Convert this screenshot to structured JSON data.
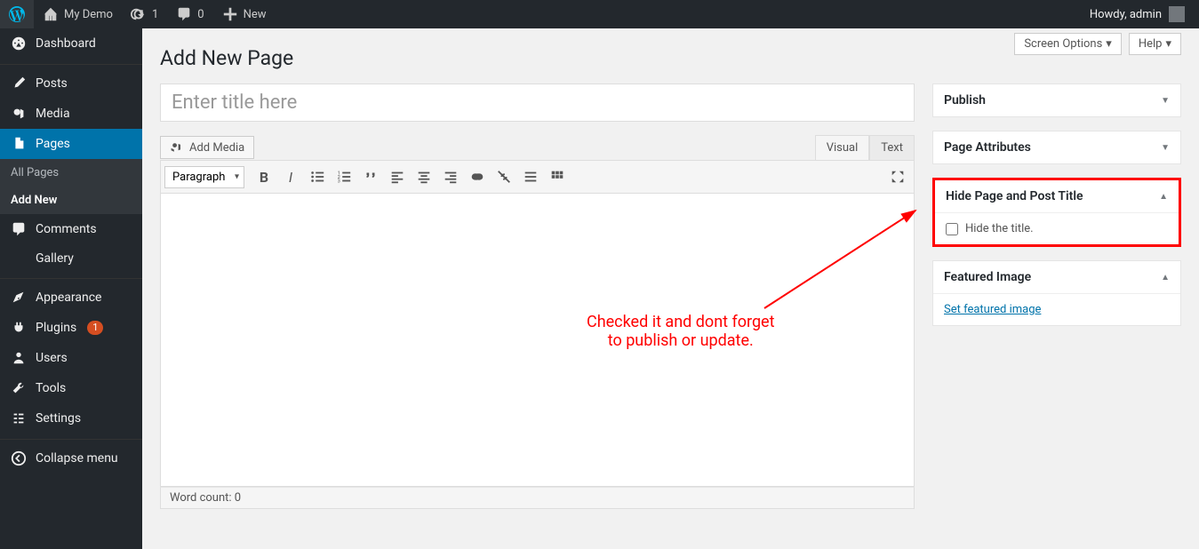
{
  "adminbar": {
    "site_name": "My Demo",
    "updates_count": "1",
    "comments_count": "0",
    "new_label": "New",
    "greeting": "Howdy, admin"
  },
  "sidebar": {
    "items": [
      {
        "label": "Dashboard",
        "key": "dashboard"
      },
      {
        "label": "Posts",
        "key": "posts"
      },
      {
        "label": "Media",
        "key": "media"
      },
      {
        "label": "Pages",
        "key": "pages",
        "current": true
      },
      {
        "label": "Comments",
        "key": "comments"
      },
      {
        "label": "Gallery",
        "key": "gallery"
      },
      {
        "label": "Appearance",
        "key": "appearance"
      },
      {
        "label": "Plugins",
        "key": "plugins",
        "badge": "1"
      },
      {
        "label": "Users",
        "key": "users"
      },
      {
        "label": "Tools",
        "key": "tools"
      },
      {
        "label": "Settings",
        "key": "settings"
      },
      {
        "label": "Collapse menu",
        "key": "collapse"
      }
    ],
    "submenu": {
      "all_pages": "All Pages",
      "add_new": "Add New"
    }
  },
  "top_buttons": {
    "screen_options": "Screen Options",
    "help": "Help"
  },
  "page": {
    "heading": "Add New Page",
    "title_placeholder": "Enter title here",
    "add_media": "Add Media",
    "tabs": {
      "visual": "Visual",
      "text": "Text"
    },
    "format_select": "Paragraph",
    "word_count": "Word count: 0"
  },
  "metaboxes": {
    "publish": {
      "title": "Publish"
    },
    "page_attributes": {
      "title": "Page Attributes"
    },
    "hide_title": {
      "title": "Hide Page and Post Title",
      "checkbox_label": "Hide the title."
    },
    "featured_image": {
      "title": "Featured Image",
      "link": "Set featured image"
    }
  },
  "annotation": {
    "line1": "Checked it and dont forget",
    "line2": "to publish or update."
  }
}
